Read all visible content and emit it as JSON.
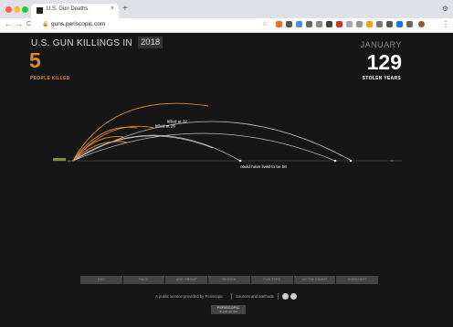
{
  "browser": {
    "tab_title": "U.S. Gun Deaths",
    "tab_close": "×",
    "new_tab": "+",
    "url": "guns.periscopic.com",
    "back": "←",
    "forward": "→",
    "reload": "C"
  },
  "header": {
    "title": "U.S. GUN KILLINGS IN",
    "year": "2018",
    "month": "JANUARY"
  },
  "stats": {
    "killed_count": "5",
    "killed_label": "PEOPLE KILLED",
    "stolen_count": "129",
    "stolen_label": "STOLEN YEARS"
  },
  "viz": {
    "annotations": [
      "killed at 32",
      "killed at 26",
      "could have lived to be 56"
    ],
    "axis_start": "age 0",
    "axis_end": "100",
    "colors": {
      "killed_arc": "#e08a2a",
      "stolen_arc": "#cccccc"
    }
  },
  "filters": [
    "SEX",
    "RACE",
    "AGE GROUP",
    "REGION",
    "GUN TYPE",
    "VICTIM COUNT",
    "HIGHLIGHT"
  ],
  "footer": {
    "credit": "A public service provided by Periscopic",
    "sources": "Sources and Methods",
    "logo_title": "PERISCOPIC",
    "logo_sub": "do good with data"
  }
}
